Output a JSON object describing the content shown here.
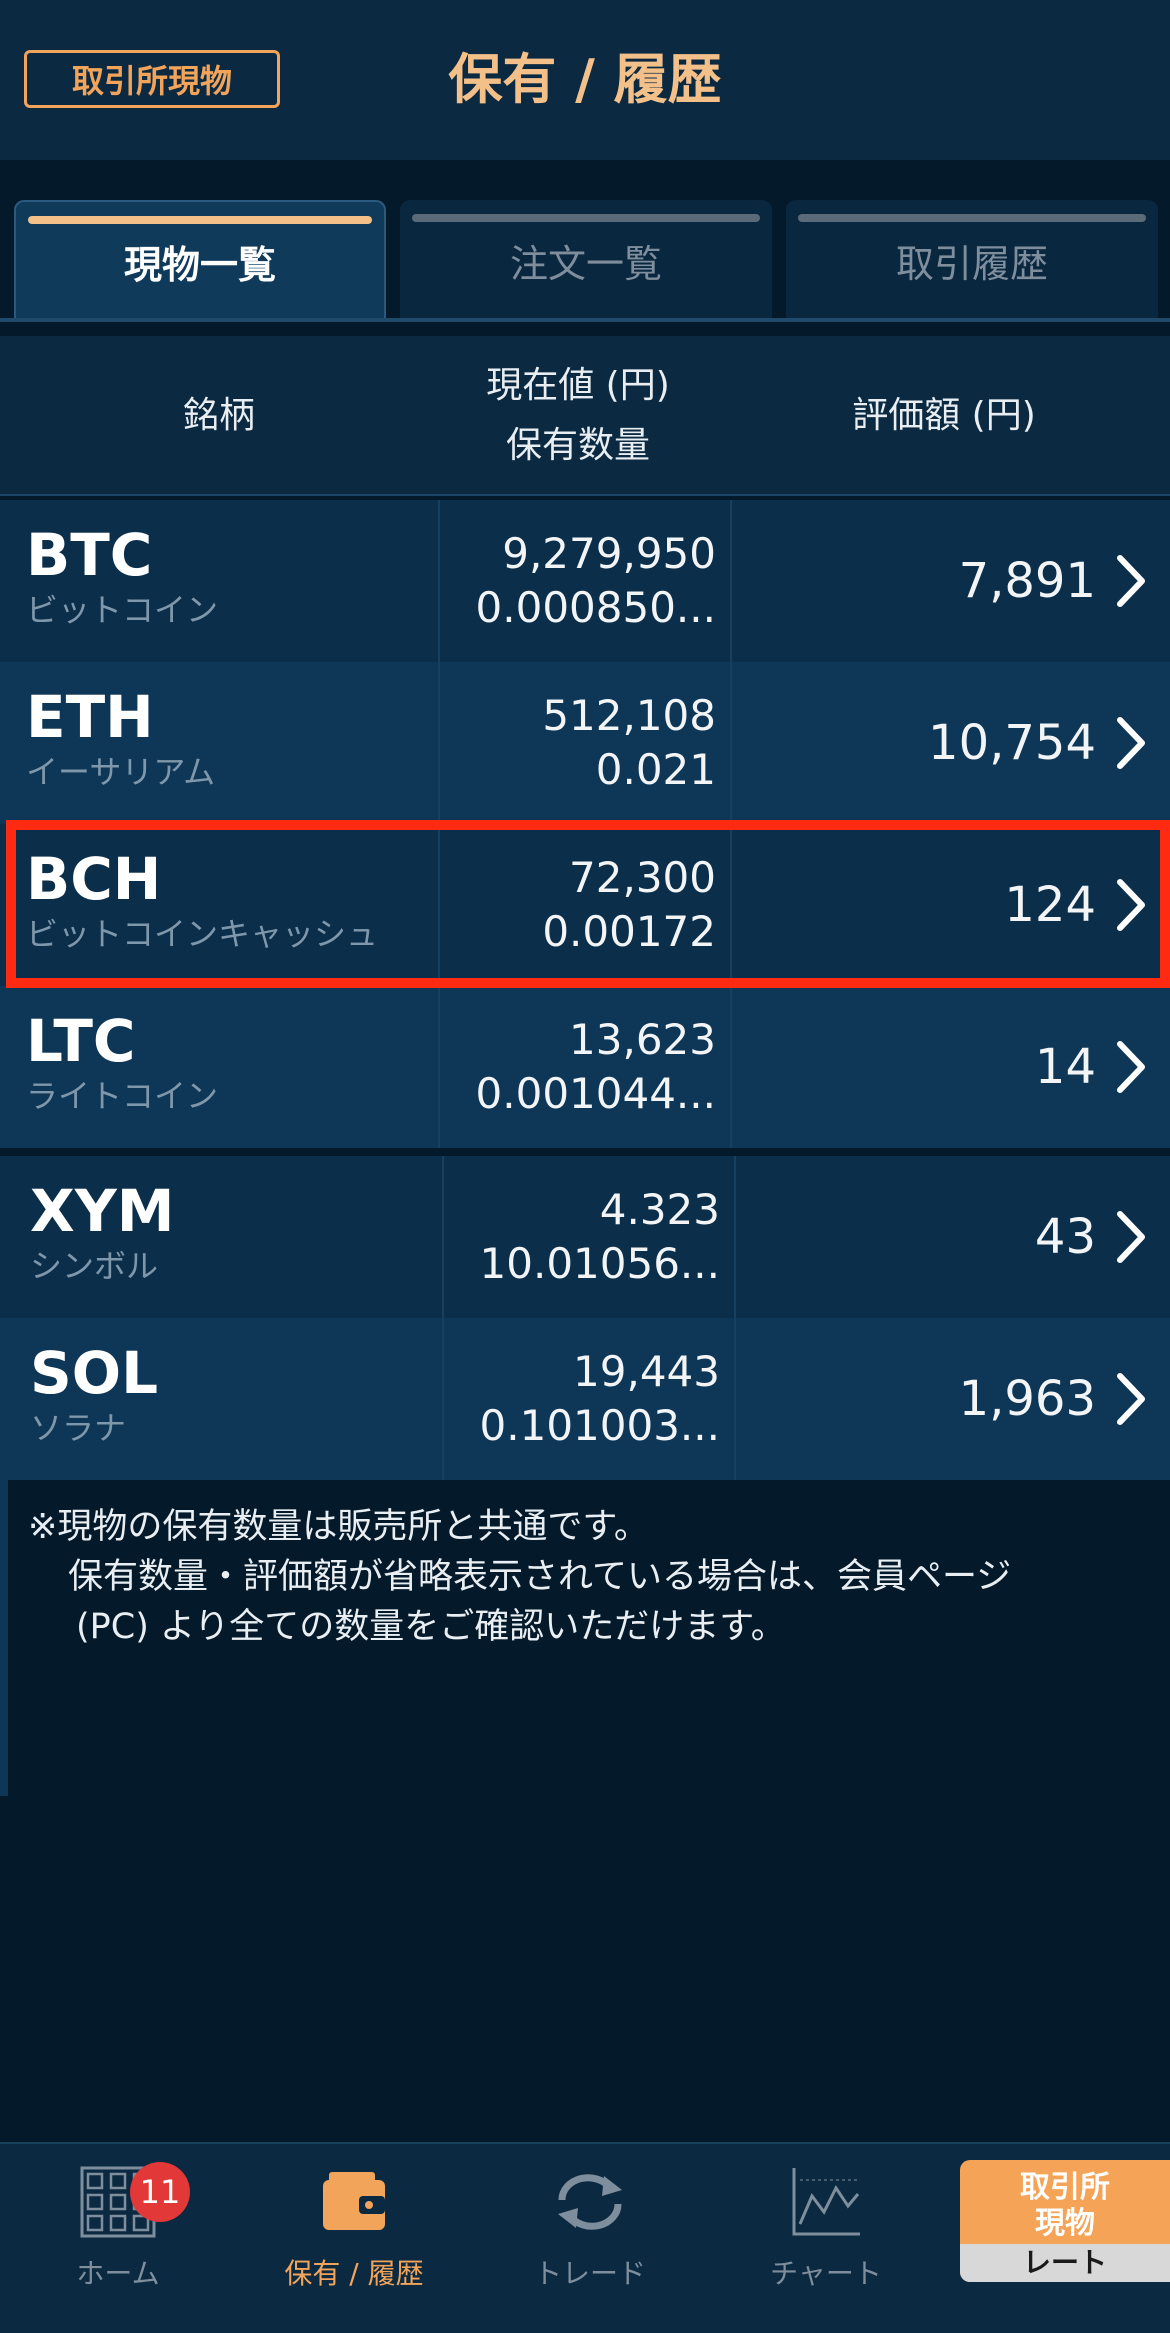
{
  "header": {
    "badge": "取引所現物",
    "title": "保有 / 履歴"
  },
  "tabs": [
    {
      "label": "現物一覧",
      "active": true
    },
    {
      "label": "注文一覧",
      "active": false
    },
    {
      "label": "取引履歴",
      "active": false
    }
  ],
  "columns": {
    "symbol": "銘柄",
    "price_line1": "現在値 (円)",
    "price_line2": "保有数量",
    "value": "評価額 (円)"
  },
  "rows": [
    {
      "symbol": "BTC",
      "name": "ビットコイン",
      "price": "9,279,950",
      "quantity": "0.000850...",
      "value": "7,891"
    },
    {
      "symbol": "ETH",
      "name": "イーサリアム",
      "price": "512,108",
      "quantity": "0.021",
      "value": "10,754"
    },
    {
      "symbol": "BCH",
      "name": "ビットコインキャッシュ",
      "price": "72,300",
      "quantity": "0.00172",
      "value": "124",
      "highlighted": true
    },
    {
      "symbol": "LTC",
      "name": "ライトコイン",
      "price": "13,623",
      "quantity": "0.001044...",
      "value": "14"
    },
    {
      "symbol": "XYM",
      "name": "シンボル",
      "price": "4.323",
      "quantity": "10.01056...",
      "value": "43"
    },
    {
      "symbol": "SOL",
      "name": "ソラナ",
      "price": "19,443",
      "quantity": "0.101003...",
      "value": "1,963"
    }
  ],
  "note": {
    "line1": "※現物の保有数量は販売所と共通です。",
    "line2": "保有数量・評価額が省略表示されている場合は、会員ページ",
    "line3": "(PC) より全ての数量をご確認いただけます。"
  },
  "nav": {
    "items": [
      {
        "label": "ホーム",
        "icon": "grid-icon",
        "badge": "11"
      },
      {
        "label": "保有 / 履歴",
        "icon": "wallet-icon",
        "active": true
      },
      {
        "label": "トレード",
        "icon": "refresh-icon"
      },
      {
        "label": "チャート",
        "icon": "chart-icon"
      }
    ],
    "rate_button": {
      "line1": "取引所",
      "line2": "現物",
      "line3": "レート"
    }
  },
  "colors": {
    "accent": "#f2a45a",
    "title": "#f4c08a",
    "highlight_border": "#ff2a12",
    "background": "#04192a"
  }
}
